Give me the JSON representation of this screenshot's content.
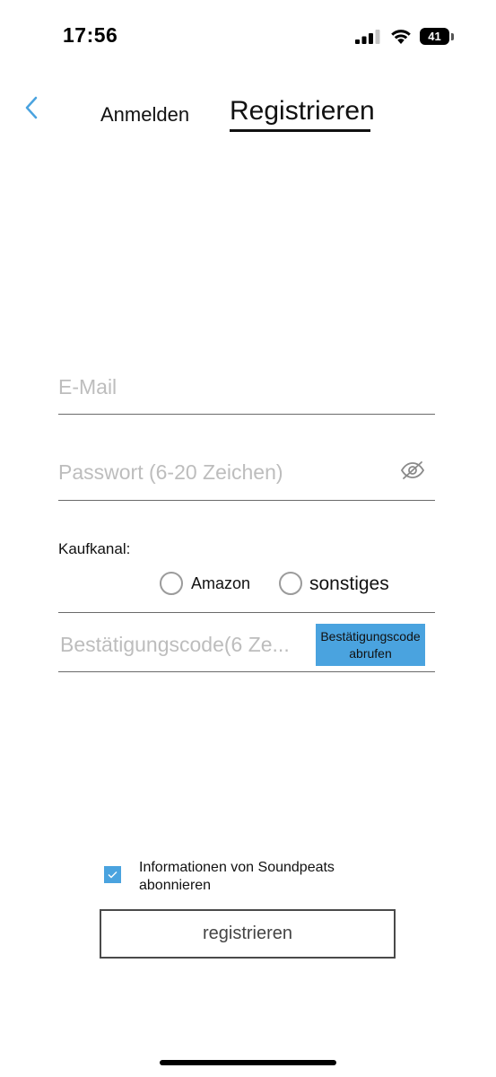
{
  "status_bar": {
    "time": "17:56",
    "battery": "41",
    "icons": [
      "signal-icon",
      "wifi-icon",
      "battery-icon"
    ]
  },
  "header": {
    "back_icon": "chevron-left-icon",
    "tabs": [
      {
        "label": "Anmelden",
        "active": false
      },
      {
        "label": "Registrieren",
        "active": true
      }
    ]
  },
  "form": {
    "email": {
      "placeholder": "E-Mail",
      "value": ""
    },
    "password": {
      "placeholder": "Passwort (6-20 Zeichen)",
      "value": "",
      "icon": "eye-slash-icon"
    },
    "purchase_channel": {
      "label": "Kaufkanal:",
      "options": [
        {
          "label": "Amazon",
          "selected": false
        },
        {
          "label": "sonstiges",
          "selected": false
        }
      ]
    },
    "code": {
      "placeholder": "Bestätigungscode(6 Ze...",
      "value": ""
    },
    "code_button": "Bestätigungscode abrufen"
  },
  "subscribe": {
    "checked": true,
    "label": "Informationen von Soundpeats abonnieren"
  },
  "submit_label": "registrieren",
  "colors": {
    "accent": "#4aa3df",
    "text": "#111111",
    "placeholder": "#bdbdbd",
    "divider": "#6a6a6a"
  }
}
